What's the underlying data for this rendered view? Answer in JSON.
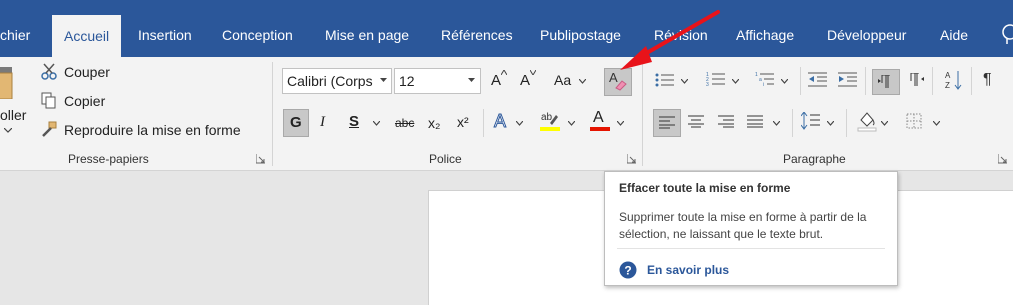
{
  "tabs": {
    "fichier": "chier",
    "accueil": "Accueil",
    "insertion": "Insertion",
    "conception": "Conception",
    "mise_en_page": "Mise en page",
    "references": "Références",
    "publipostage": "Publipostage",
    "revision": "Révision",
    "affichage": "Affichage",
    "developpeur": "Développeur",
    "aide": "Aide"
  },
  "clipboard": {
    "paste": "oller",
    "cut": "Couper",
    "copy": "Copier",
    "format_painter": "Reproduire la mise en forme",
    "group_label": "Presse-papiers"
  },
  "font": {
    "name": "Calibri (Corps",
    "size": "12",
    "group_label": "Police",
    "bold": "G",
    "italic": "I",
    "underline": "S",
    "strike": "abc",
    "subscript": "x₂",
    "superscript": "x²",
    "change_case": "Aa",
    "grow": "A",
    "shrink": "A",
    "text_effects": "A",
    "font_color": "A",
    "clear_format": "A"
  },
  "paragraph": {
    "group_label": "Paragraphe",
    "show_marks": "¶"
  },
  "tooltip": {
    "title": "Effacer toute la mise en forme",
    "description": "Supprimer toute la mise en forme à partir de la sélection, ne laissant que le texte brut.",
    "link": "En savoir plus"
  },
  "colors": {
    "accent": "#2b579a",
    "ribbon_bg": "#f3f3f3",
    "highlight": "#ffff00",
    "font_red": "#e51400",
    "arrow_red": "#e8131a"
  }
}
